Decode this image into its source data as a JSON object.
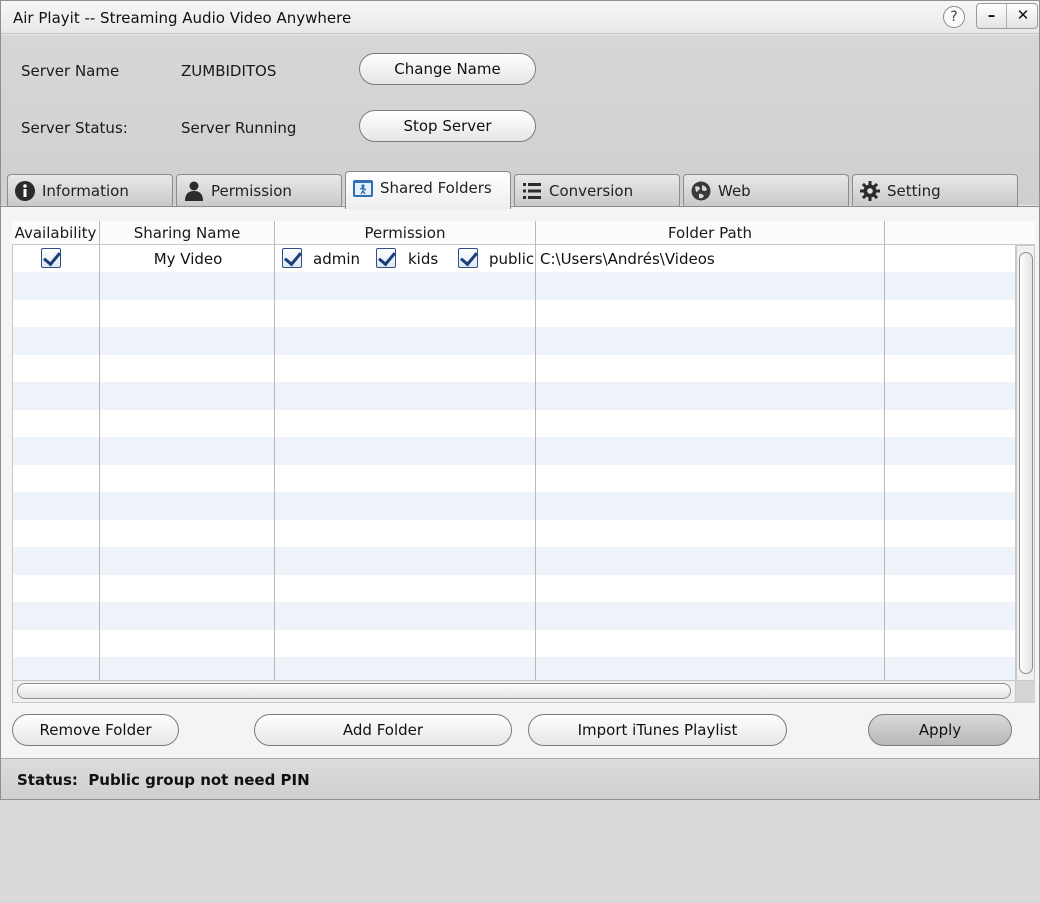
{
  "window": {
    "title": "Air Playit -- Streaming Audio Video Anywhere",
    "help_glyph": "?",
    "minimize_glyph": "–",
    "close_glyph": "✕"
  },
  "server": {
    "name_label": "Server Name",
    "name_value": "ZUMBIDITOS",
    "change_name_button": "Change Name",
    "status_label": "Server Status:",
    "status_value": "Server Running",
    "stop_server_button": "Stop Server"
  },
  "tabs": [
    {
      "label": "Information",
      "icon": "info-icon",
      "active": false
    },
    {
      "label": "Permission",
      "icon": "user-icon",
      "active": false
    },
    {
      "label": "Shared Folders",
      "icon": "folder-share-icon",
      "active": true
    },
    {
      "label": "Conversion",
      "icon": "list-icon",
      "active": false
    },
    {
      "label": "Web",
      "icon": "globe-icon",
      "active": false
    },
    {
      "label": "Setting",
      "icon": "gear-icon",
      "active": false
    }
  ],
  "table": {
    "columns": [
      "Availability",
      "Sharing Name",
      "Permission",
      "Folder Path"
    ],
    "rows": [
      {
        "available": true,
        "sharing_name": "My Video",
        "permissions": [
          {
            "name": "admin",
            "checked": true
          },
          {
            "name": "kids",
            "checked": true
          },
          {
            "name": "public",
            "checked": true
          }
        ],
        "folder_path": "C:\\Users\\Andrés\\Videos"
      }
    ]
  },
  "actions": {
    "remove_folder": "Remove Folder",
    "add_folder": "Add Folder",
    "import_itunes": "Import iTunes Playlist",
    "apply": "Apply"
  },
  "status": {
    "text": "Status:  Public group not need PIN"
  }
}
